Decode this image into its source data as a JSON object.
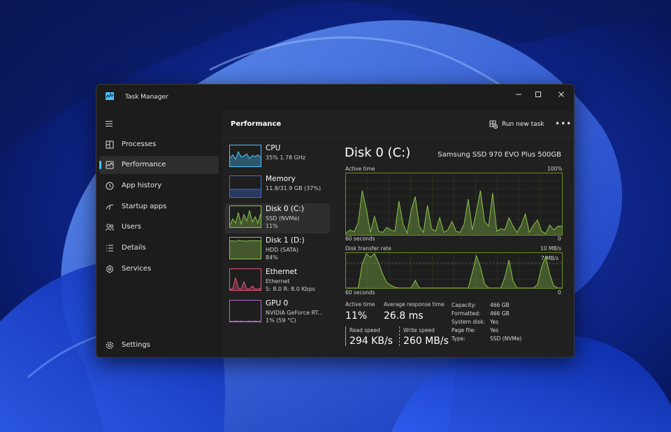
{
  "colors": {
    "cpu": "#4cc2ff",
    "memory": "#3b6fd6",
    "disk": "#8bc34a",
    "ethernet": "#e0567a",
    "gpu": "#b067c9",
    "accent": "#4cc2ff"
  },
  "window": {
    "title": "Task Manager",
    "controls": [
      "minimize-icon",
      "maximize-icon",
      "close-icon"
    ]
  },
  "sidebar": {
    "items": [
      {
        "label": "Processes",
        "icon": "processes-icon"
      },
      {
        "label": "Performance",
        "icon": "performance-icon",
        "active": true
      },
      {
        "label": "App history",
        "icon": "history-icon"
      },
      {
        "label": "Startup apps",
        "icon": "startup-icon"
      },
      {
        "label": "Users",
        "icon": "users-icon"
      },
      {
        "label": "Details",
        "icon": "details-icon"
      },
      {
        "label": "Services",
        "icon": "services-icon"
      }
    ],
    "settings": {
      "label": "Settings",
      "icon": "gear-icon"
    }
  },
  "header": {
    "title": "Performance",
    "run_new_task": "Run new task",
    "more": "•••"
  },
  "devices": [
    {
      "name": "CPU",
      "lines": [
        "35%  1.78 GHz"
      ]
    },
    {
      "name": "Memory",
      "lines": [
        "11.8/31.9 GB (37%)"
      ]
    },
    {
      "name": "Disk 0 (C:)",
      "lines": [
        "SSD (NVMe)",
        "11%"
      ],
      "active": true
    },
    {
      "name": "Disk 1 (D:)",
      "lines": [
        "HDD (SATA)",
        "84%"
      ]
    },
    {
      "name": "Ethernet",
      "lines": [
        "Ethernet",
        "S: 8.0  R: 8.0 Kbps"
      ]
    },
    {
      "name": "GPU 0",
      "lines": [
        "NVIDIA GeForce RT...",
        "1% (59 °C)"
      ]
    }
  ],
  "detail": {
    "title": "Disk 0 (C:)",
    "model": "Samsung SSD 970 EVO Plus 500GB",
    "active_graph": {
      "label": "Active time",
      "max": "100%",
      "time": "60 seconds",
      "min": "0"
    },
    "transfer_graph": {
      "label": "Disk transfer rate",
      "max": "10 MB/s",
      "marker": "7 MB/s",
      "time": "60 seconds",
      "min": "0"
    },
    "stats": {
      "active_time_label": "Active time",
      "active_time_value": "11%",
      "avg_response_label": "Average response time",
      "avg_response_value": "26.8 ms",
      "read_label": "Read speed",
      "read_value": "294 KB/s",
      "write_label": "Write speed",
      "write_value": "260 MB/s"
    },
    "properties": [
      {
        "k": "Capacity:",
        "v": "466 GB"
      },
      {
        "k": "Formatted:",
        "v": "466 GB"
      },
      {
        "k": "System disk:",
        "v": "Yes"
      },
      {
        "k": "Page file:",
        "v": "Yes"
      },
      {
        "k": "Type:",
        "v": "SSD (NVMe)"
      }
    ]
  },
  "series": {
    "active_time": [
      3,
      8,
      5,
      20,
      72,
      42,
      4,
      30,
      6,
      4,
      12,
      8,
      6,
      55,
      18,
      3,
      40,
      62,
      14,
      4,
      48,
      10,
      6,
      28,
      4,
      8,
      22,
      6,
      4,
      18,
      58,
      8,
      38,
      72,
      22,
      14,
      68,
      6,
      10,
      8,
      28,
      14,
      4,
      16,
      34,
      4,
      16,
      24,
      6,
      2,
      16,
      8,
      14,
      14
    ],
    "transfer_rate": [
      0,
      0,
      0,
      0,
      70,
      98,
      88,
      98,
      72,
      40,
      16,
      8,
      2,
      0,
      0,
      0,
      0,
      22,
      0,
      0,
      0,
      0,
      0,
      0,
      0,
      0,
      0,
      0,
      0,
      0,
      0,
      44,
      92,
      60,
      12,
      0,
      0,
      0,
      0,
      32,
      80,
      20,
      0,
      0,
      0,
      0,
      0,
      10,
      60,
      90,
      40,
      6,
      0,
      0
    ],
    "thumb_cpu": [
      40,
      55,
      35,
      70,
      45,
      50,
      60,
      38,
      52,
      47,
      55,
      42
    ],
    "thumb_memory": [
      37,
      37,
      38,
      37,
      38,
      37,
      37,
      38,
      37,
      37,
      37,
      38
    ],
    "thumb_disk0": [
      10,
      40,
      20,
      70,
      15,
      60,
      30,
      80,
      25,
      50,
      20,
      65
    ],
    "thumb_disk1": [
      84,
      86,
      82,
      88,
      84,
      85,
      83,
      87,
      84,
      86,
      85,
      84
    ],
    "thumb_ethernet": [
      5,
      5,
      60,
      10,
      5,
      40,
      5,
      5,
      20,
      5,
      5,
      10
    ],
    "thumb_gpu": [
      2,
      1,
      3,
      1,
      2,
      1,
      1,
      2,
      1,
      3,
      1,
      2
    ]
  }
}
